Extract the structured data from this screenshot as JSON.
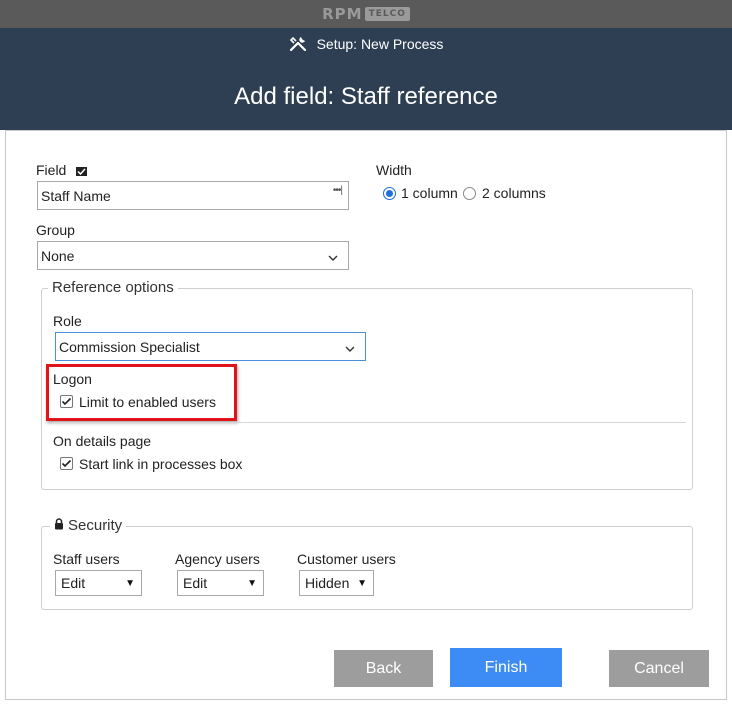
{
  "brand": {
    "main": "RPM",
    "sub": "TELCO"
  },
  "header": {
    "crumb_icon": "tools-icon",
    "crumb": "Setup: New Process",
    "title": "Add field: Staff reference"
  },
  "form": {
    "field": {
      "label": "Field",
      "value": "Staff Name",
      "dots": "•••|"
    },
    "width": {
      "label": "Width",
      "options": [
        {
          "label": "1 column",
          "selected": true
        },
        {
          "label": "2 columns",
          "selected": false
        }
      ]
    },
    "group": {
      "label": "Group",
      "value": "None"
    },
    "reference": {
      "legend": "Reference options",
      "role": {
        "label": "Role",
        "value": "Commission Specialist"
      },
      "logon": {
        "label": "Logon",
        "checkbox_label": "Limit to enabled users",
        "checked": true
      },
      "details": {
        "label": "On details page",
        "checkbox_label": "Start link in processes box",
        "checked": true
      }
    },
    "security": {
      "legend": "Security",
      "staff": {
        "label": "Staff users",
        "value": "Edit"
      },
      "agency": {
        "label": "Agency users",
        "value": "Edit"
      },
      "customer": {
        "label": "Customer users",
        "value": "Hidden"
      }
    }
  },
  "buttons": {
    "back": "Back",
    "finish": "Finish",
    "cancel": "Cancel"
  },
  "colors": {
    "header_bg": "#2e3f54",
    "topbar_bg": "#5a5a5a",
    "primary": "#3d8cf5",
    "secondary": "#9d9d9d",
    "highlight": "#e0141a"
  }
}
